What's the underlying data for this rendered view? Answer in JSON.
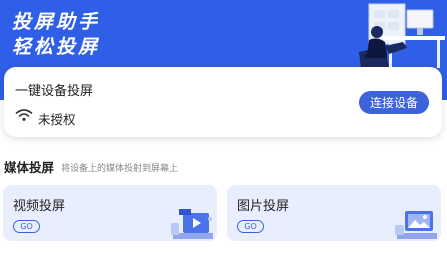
{
  "hero": {
    "title_line1": "投屏助手",
    "title_line2": "轻松投屏",
    "illustration": "person-at-desk-illustration"
  },
  "connect_card": {
    "title": "一键设备投屏",
    "status_icon": "wifi-icon",
    "status_text": "未授权",
    "connect_button": "连接设备"
  },
  "media_section": {
    "title": "媒体投屏",
    "subtitle": "将设备上的媒体投射到屏幕上",
    "cards": [
      {
        "label": "视频投屏",
        "go_label": "GO",
        "icon": "video-cast-icon"
      },
      {
        "label": "图片投屏",
        "go_label": "GO",
        "icon": "image-cast-icon"
      }
    ]
  },
  "colors": {
    "hero_bg": "#2f5fe6",
    "accent": "#3c63db",
    "card_bg": "#e8eefd"
  }
}
